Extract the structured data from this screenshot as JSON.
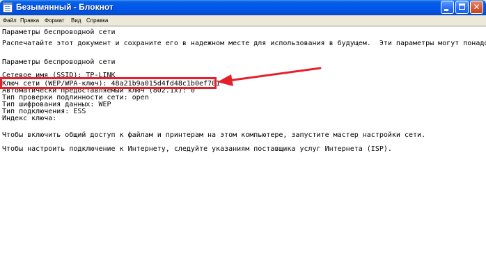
{
  "window": {
    "title": "Безымянный - Блокнот"
  },
  "menu": {
    "items": [
      "Файл",
      "Правка",
      "Формат",
      "Вид",
      "Справка"
    ]
  },
  "editor": {
    "lines": [
      "Параметры беспроводной сети",
      "Распечатайте этот документ и сохраните его в надежном месте для использования в будущем.  Эти параметры могут понадо",
      "Параметры беспроводной сети",
      "Сетевое имя (SSID): TP-LINK",
      "Ключ сети (WEP/WPA-ключ): 48a21b9a015d4fd48c1b0ef701",
      "Автоматически предоставляемый ключ (802.1x): 0",
      "Тип проверки подлинности сети: open",
      "Тип шифрования данных: WEP",
      "Тип подключения: ESS",
      "Индекс ключа:",
      "Чтобы включить общий доступ к файлам и принтерам на этом компьютере, запустите мастер настройки сети.",
      "Чтобы настроить подключение к Интернету, следуйте указаниям поставщика услуг Интернета (ISP)."
    ]
  },
  "annotation": {
    "color": "#e5202a",
    "icon": "red-arrow-icon"
  },
  "colors": {
    "titlebar": "#0058ee",
    "close_button": "#d85a36",
    "menubar": "#ece9d8"
  }
}
